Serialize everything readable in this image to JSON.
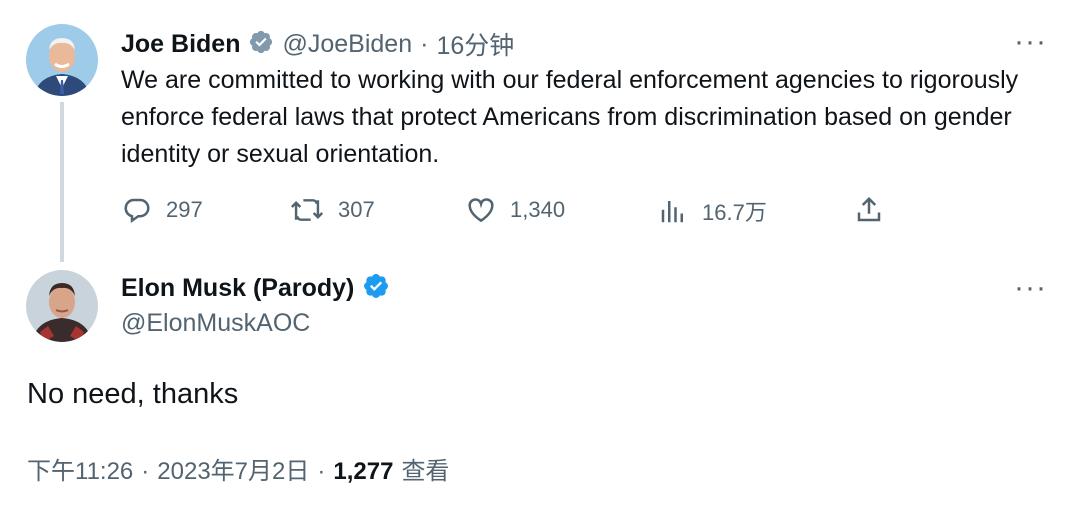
{
  "tweet1": {
    "name": "Joe Biden",
    "handle": "@JoeBiden",
    "sep": "·",
    "time": "16分钟",
    "text": "We are committed to working with our federal enforcement agencies to rigorously enforce federal laws that protect Americans from discrimination based on gender identity or sexual orientation.",
    "more": "···",
    "actions": {
      "replies": "297",
      "retweets": "307",
      "likes": "1,340",
      "views": "16.7万"
    },
    "badge_color": "#829aab",
    "icons": [
      "reply-icon",
      "retweet-icon",
      "like-icon",
      "views-icon",
      "share-icon"
    ]
  },
  "tweet2": {
    "name": "Elon Musk (Parody)",
    "handle": "@ElonMuskAOC",
    "text": "No need, thanks",
    "more": "···",
    "badge_color": "#1d9bf0",
    "meta": {
      "time": "下午11:26",
      "sep1": "·",
      "date": "2023年7月2日",
      "sep2": "·",
      "views_count": "1,277",
      "views_label": "查看"
    }
  },
  "colors": {
    "text": "#0f1419",
    "muted": "#536471",
    "thread_line": "#cfd9de"
  }
}
